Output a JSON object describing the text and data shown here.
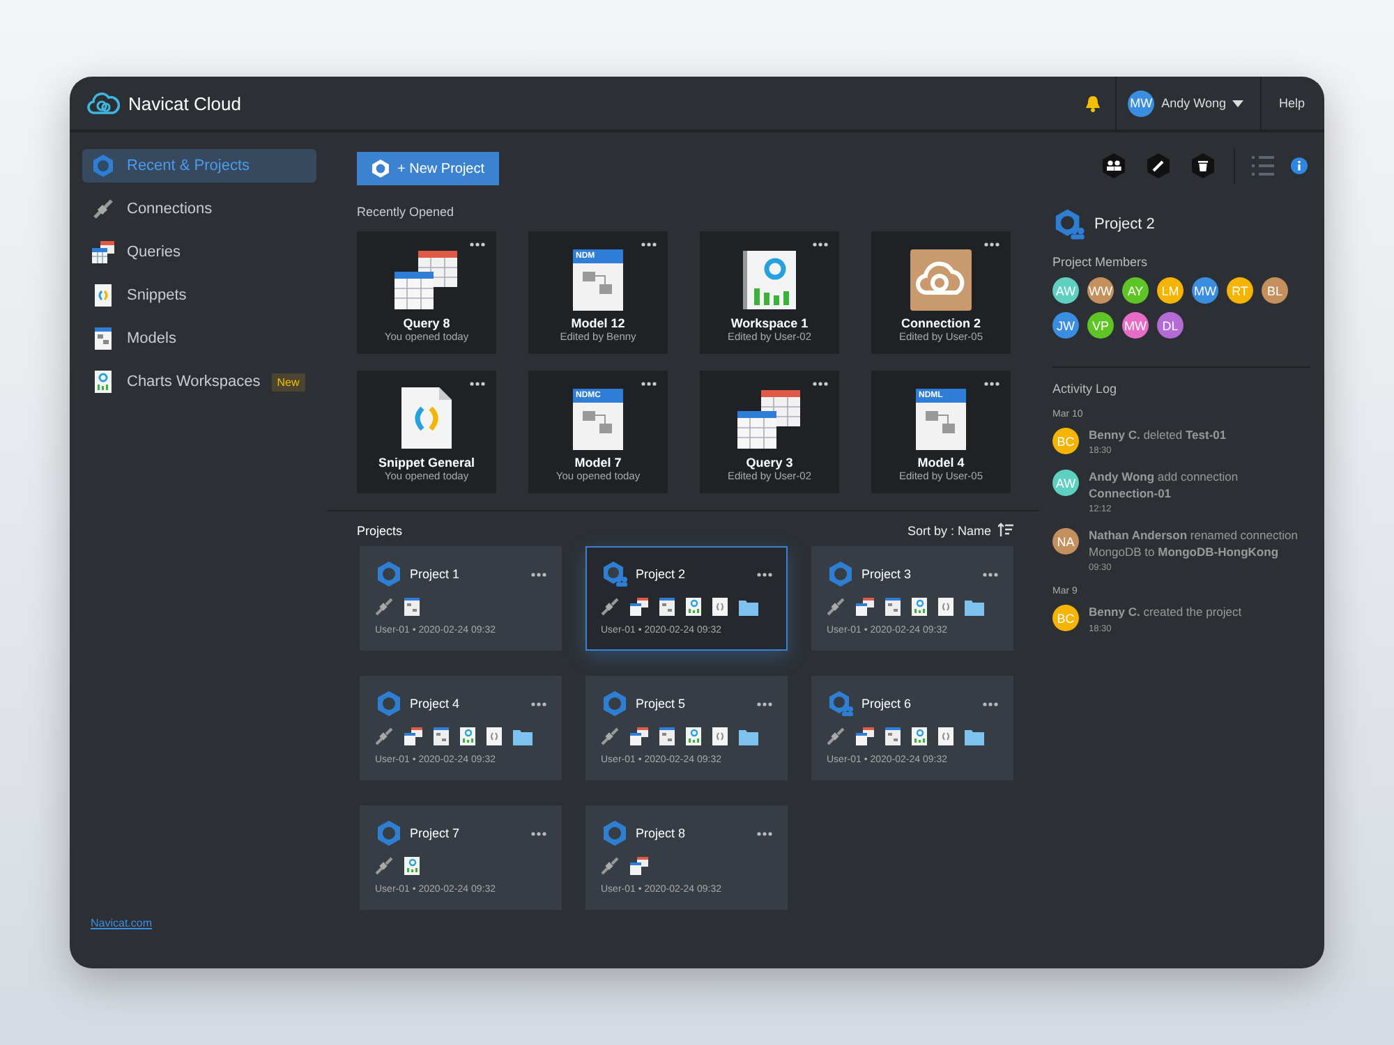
{
  "header": {
    "title": "Navicat Cloud",
    "user": {
      "initials": "MW",
      "name": "Andy Wong",
      "color": "#3b8de0"
    },
    "help": "Help"
  },
  "sidebar": {
    "items": [
      {
        "kind": "recent",
        "label": "Recent & Projects",
        "selected": true
      },
      {
        "kind": "connections",
        "label": "Connections",
        "selected": false
      },
      {
        "kind": "queries",
        "label": "Queries",
        "selected": false
      },
      {
        "kind": "snippets",
        "label": "Snippets",
        "selected": false
      },
      {
        "kind": "models",
        "label": "Models",
        "selected": false
      },
      {
        "kind": "charts",
        "label": "Charts Workspaces",
        "selected": false,
        "badge": "New"
      }
    ],
    "footer_link": "Navicat.com"
  },
  "new_project_button": "+ New Project",
  "recently_opened": {
    "title": "Recently Opened",
    "items": [
      {
        "kind": "query",
        "title": "Query 8",
        "subtitle": "You opened today"
      },
      {
        "kind": "model",
        "badge": "NDM",
        "title": "Model 12",
        "subtitle": "Edited by Benny"
      },
      {
        "kind": "chart",
        "title": "Workspace 1",
        "subtitle": "Edited by User-02"
      },
      {
        "kind": "connection",
        "title": "Connection 2",
        "subtitle": "Edited by User-05"
      },
      {
        "kind": "snippet",
        "title": "Snippet General",
        "subtitle": "You opened today"
      },
      {
        "kind": "model",
        "badge": "NDMC",
        "title": "Model 7",
        "subtitle": "You opened today"
      },
      {
        "kind": "query",
        "title": "Query 3",
        "subtitle": "Edited by User-02"
      },
      {
        "kind": "model",
        "badge": "NDML",
        "title": "Model 4",
        "subtitle": "Edited by User-05"
      }
    ]
  },
  "projects": {
    "title": "Projects",
    "sort": "Sort by : Name",
    "items": [
      {
        "name": "Project 1",
        "shared": false,
        "selected": false,
        "files": [
          {
            "kind": "connection"
          },
          {
            "kind": "model"
          }
        ],
        "meta": "User-01 • 2020-02-24 09:32"
      },
      {
        "name": "Project 2",
        "shared": true,
        "selected": true,
        "files": [
          {
            "kind": "connection"
          },
          {
            "kind": "query"
          },
          {
            "kind": "model"
          },
          {
            "kind": "chart"
          },
          {
            "kind": "snippet"
          },
          {
            "kind": "folder"
          }
        ],
        "meta": "User-01 • 2020-02-24 09:32"
      },
      {
        "name": "Project 3",
        "shared": false,
        "selected": false,
        "files": [
          {
            "kind": "connection"
          },
          {
            "kind": "query"
          },
          {
            "kind": "model"
          },
          {
            "kind": "chart"
          },
          {
            "kind": "snippet"
          },
          {
            "kind": "folder"
          }
        ],
        "meta": "User-01 • 2020-02-24 09:32"
      },
      {
        "name": "Project 4",
        "shared": false,
        "selected": false,
        "files": [
          {
            "kind": "connection"
          },
          {
            "kind": "query"
          },
          {
            "kind": "model"
          },
          {
            "kind": "chart"
          },
          {
            "kind": "snippet"
          },
          {
            "kind": "folder"
          }
        ],
        "meta": "User-01 • 2020-02-24 09:32"
      },
      {
        "name": "Project 5",
        "shared": false,
        "selected": false,
        "files": [
          {
            "kind": "connection"
          },
          {
            "kind": "query"
          },
          {
            "kind": "model"
          },
          {
            "kind": "chart"
          },
          {
            "kind": "snippet"
          },
          {
            "kind": "folder"
          }
        ],
        "meta": "User-01 • 2020-02-24 09:32"
      },
      {
        "name": "Project 6",
        "shared": true,
        "selected": false,
        "files": [
          {
            "kind": "connection"
          },
          {
            "kind": "query"
          },
          {
            "kind": "model"
          },
          {
            "kind": "chart"
          },
          {
            "kind": "snippet"
          },
          {
            "kind": "folder"
          }
        ],
        "meta": "User-01 • 2020-02-24 09:32"
      },
      {
        "name": "Project 7",
        "shared": false,
        "selected": false,
        "files": [
          {
            "kind": "connection"
          },
          {
            "kind": "chart"
          }
        ],
        "meta": "User-01 • 2020-02-24 09:32"
      },
      {
        "name": "Project 8",
        "shared": false,
        "selected": false,
        "files": [
          {
            "kind": "connection"
          },
          {
            "kind": "query"
          }
        ],
        "meta": "User-01 • 2020-02-24 09:32"
      }
    ]
  },
  "details": {
    "project_name": "Project 2",
    "members_title": "Project Members",
    "members": [
      {
        "initials": "AW",
        "color": "#5ecfc0"
      },
      {
        "initials": "WW",
        "color": "#c4915e"
      },
      {
        "initials": "AY",
        "color": "#5fc426"
      },
      {
        "initials": "LM",
        "color": "#f5b400"
      },
      {
        "initials": "MW",
        "color": "#3b8de0"
      },
      {
        "initials": "RT",
        "color": "#f5b400"
      },
      {
        "initials": "BL",
        "color": "#c4915e"
      },
      {
        "initials": "JW",
        "color": "#3b8de0"
      },
      {
        "initials": "VP",
        "color": "#5fc426"
      },
      {
        "initials": "MW",
        "color": "#e96bc8"
      },
      {
        "initials": "DL",
        "color": "#b46bd6"
      }
    ],
    "activity_title": "Activity Log",
    "activity": [
      {
        "date": "Mar 10",
        "entries": [
          {
            "initials": "BC",
            "color": "#f5b400",
            "text": "**Benny C.** deleted **Test-01**",
            "time": "18:30"
          },
          {
            "initials": "AW",
            "color": "#5ecfc0",
            "text": "**Andy Wong** add connection **Connection-01**",
            "time": "12:12"
          },
          {
            "initials": "NA",
            "color": "#c4915e",
            "text": "**Nathan Anderson** renamed connection MongoDB to **MongoDB-HongKong**",
            "time": "09:30"
          }
        ]
      },
      {
        "date": "Mar 9",
        "entries": [
          {
            "initials": "BC",
            "color": "#f5b400",
            "text": "**Benny C.** created the project",
            "time": "18:30"
          }
        ]
      }
    ]
  }
}
